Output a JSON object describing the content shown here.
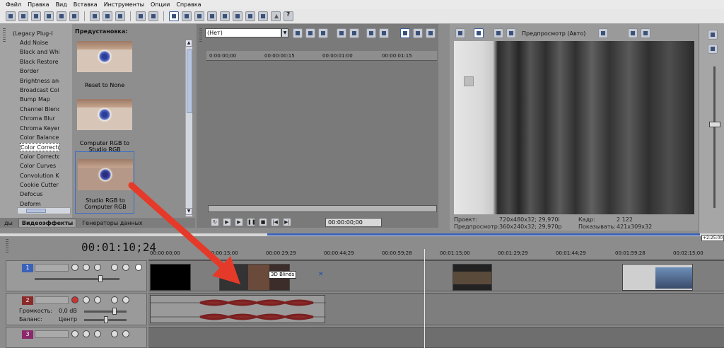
{
  "menu": [
    "Файл",
    "Правка",
    "Вид",
    "Вставка",
    "Инструменты",
    "Опции",
    "Справка"
  ],
  "effects": {
    "root_label": "(Legacy Plug-I",
    "items": [
      "Add Noise",
      "Black and White",
      "Black Restore",
      "Border",
      "Brightness and",
      "Broadcast Colo",
      "Bump Map",
      "Channel Blend",
      "Chroma Blur",
      "Chroma Keyer",
      "Color Balance",
      "Color Correcto",
      "Color Correcto",
      "Color Curves",
      "Convolution Ke",
      "Cookie Cutter",
      "Defocus",
      "Deform"
    ],
    "selected_index": 11
  },
  "presets": {
    "header": "Предустановка:",
    "items": [
      "Reset to None",
      "Computer RGB to Studio RGB",
      "Studio RGB to Computer RGB"
    ],
    "selected_index": 2
  },
  "tabs": [
    "ды",
    "Видеоэффекты",
    "Генераторы данных"
  ],
  "active_tab": 1,
  "trimmer": {
    "source": "(Нет)",
    "ruler": [
      "0:00:00;00",
      "00:00:00:15",
      "00:00:01:00",
      "00:00:01:15"
    ],
    "time": "00:00:00;00"
  },
  "preview": {
    "mode": "Предпросмотр (Авто)",
    "project_label": "Проект:",
    "project_value": "720x480x32; 29,970i",
    "preview_label": "Предпросмотр:",
    "preview_value": "360x240x32; 29,970p",
    "frame_label": "Кадр:",
    "frame_value": "2 122",
    "display_label": "Показывать:",
    "display_value": "421x309x32"
  },
  "timeline": {
    "current_time": "00:01:10;24",
    "ruler": [
      "00:00:00;00",
      "00:00:15;00",
      "00:00:29;29",
      "00:00:44;29",
      "00:00:59;28",
      "00:01:15;00",
      "00:01:29;29",
      "00:01:44;29",
      "00:01:59;28",
      "00:02:15;00"
    ],
    "end_marker": "+2:25:00",
    "tracks": [
      {
        "number": "1",
        "type": "video",
        "color": "#3a62b8"
      },
      {
        "number": "2",
        "type": "audio",
        "color": "#8a2a2a",
        "volume_label": "Громкость:",
        "volume_value": "0,0 dB",
        "pan_label": "Баланс:",
        "pan_value": "Центр"
      },
      {
        "number": "3",
        "type": "video",
        "color": "#8a2a6a"
      }
    ],
    "transition_label": "3D Blinds"
  }
}
